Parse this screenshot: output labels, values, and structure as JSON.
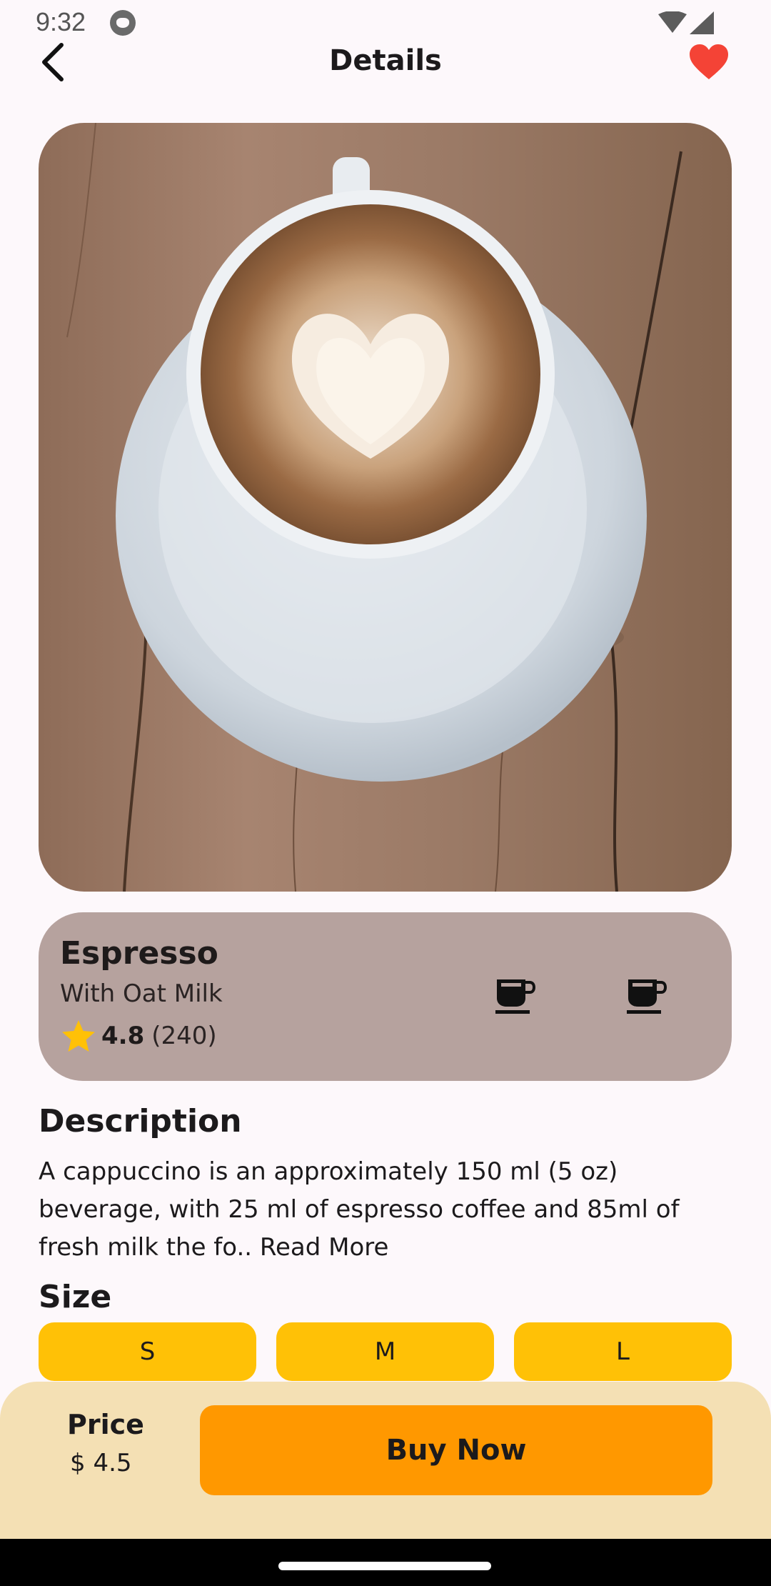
{
  "status_bar": {
    "time": "9:32"
  },
  "app_bar": {
    "title": "Details"
  },
  "product": {
    "name": "Espresso",
    "subtitle": "With Oat Milk",
    "rating": "4.8",
    "rating_count": "(240)"
  },
  "description": {
    "heading": "Description",
    "text": "A cappuccino is an approximately 150 ml (5 oz) beverage, with 25 ml of espresso coffee and 85ml of fresh milk the fo..",
    "read_more": "Read More"
  },
  "size": {
    "heading": "Size",
    "options": [
      "S",
      "M",
      "L"
    ]
  },
  "bottom_bar": {
    "price_label": "Price",
    "price_value": "$ 4.5",
    "buy_label": "Buy Now"
  },
  "colors": {
    "accent": "#ff9800",
    "size_button": "#ffc106",
    "info_card": "#b6a29e",
    "bottom_bar": "#f4e0b4",
    "favorite": "#f44336"
  },
  "icons": {
    "back": "arrow-back-icon",
    "favorite": "heart-icon",
    "rating": "star-icon",
    "cup": "coffee-cup-icon"
  }
}
